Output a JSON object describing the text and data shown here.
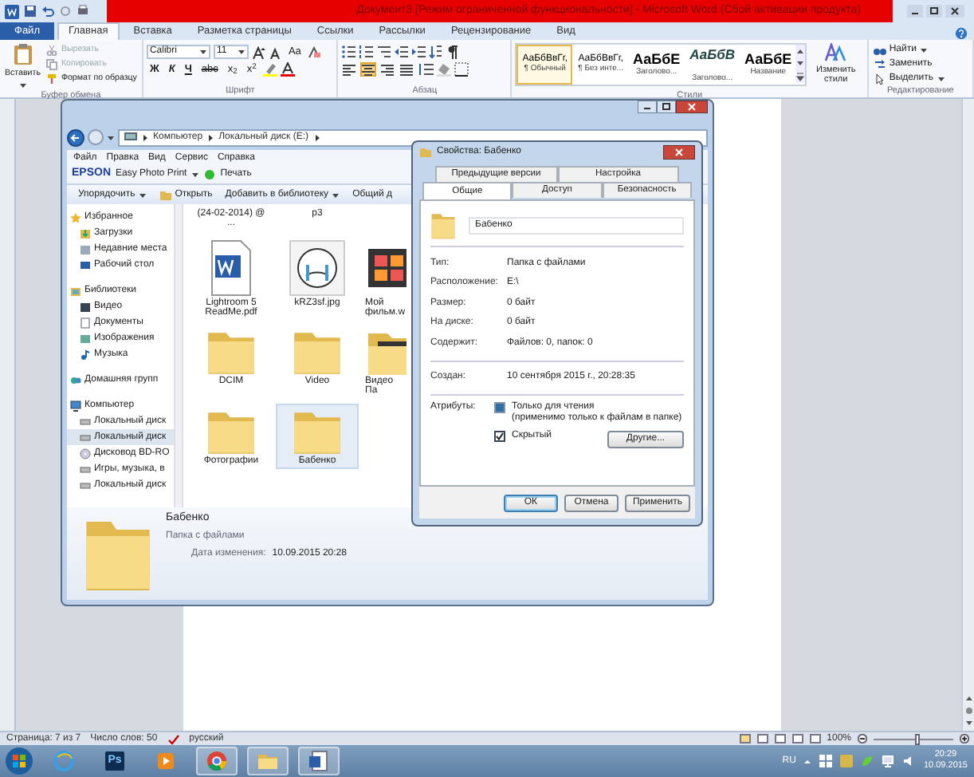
{
  "word": {
    "title": "Документ3 [Режим ограниченной функциональности] - Microsoft Word (Сбой активации продукта)",
    "tabs": [
      {
        "label": "Файл",
        "kind": "file",
        "selected": false
      },
      {
        "label": "Главная",
        "kind": "tab",
        "selected": true
      },
      {
        "label": "Вставка",
        "kind": "tab",
        "selected": false
      },
      {
        "label": "Разметка страницы",
        "kind": "tab",
        "selected": false
      },
      {
        "label": "Ссылки",
        "kind": "tab",
        "selected": false
      },
      {
        "label": "Рассылки",
        "kind": "tab",
        "selected": false
      },
      {
        "label": "Рецензирование",
        "kind": "tab",
        "selected": false
      },
      {
        "label": "Вид",
        "kind": "tab",
        "selected": false
      }
    ],
    "clipboard": {
      "paste": "Вставить",
      "items": [
        {
          "label": "Вырезать",
          "kind": "cut",
          "disabled": true
        },
        {
          "label": "Копировать",
          "kind": "copy",
          "disabled": true
        },
        {
          "label": "Формат по образцу",
          "kind": "brush",
          "disabled": false
        }
      ],
      "group": "Буфер обмена"
    },
    "font": {
      "name": "Calibri",
      "size": "11",
      "case_button": "Aa",
      "style_buttons": [
        "Ж",
        "К",
        "Ч"
      ],
      "effect_buttons": [
        "abc",
        "x$_{2}$",
        "x$^{2}$"
      ],
      "group": "Шрифт"
    },
    "paragraph": {
      "align": [
        {
          "kind": "left",
          "selected": false
        },
        {
          "kind": "center",
          "selected": true
        },
        {
          "kind": "right",
          "selected": false
        },
        {
          "kind": "justify",
          "selected": false
        }
      ],
      "group": "Абзац"
    },
    "styles": {
      "items": [
        {
          "sample": "АаБбВвГг,",
          "name": "¶ Обычный",
          "kind": "body",
          "selected": true
        },
        {
          "sample": "АаБбВвГг,",
          "name": "¶ Без инте...",
          "kind": "body",
          "selected": false
        },
        {
          "sample": "АаБбЕ",
          "name": "Заголово...",
          "kind": "heading",
          "selected": false
        },
        {
          "sample": "АаБбВ",
          "name": "Заголово...",
          "kind": "heading2",
          "selected": false
        },
        {
          "sample": "АаБбЕ",
          "name": "Название",
          "kind": "heading",
          "selected": false
        }
      ],
      "change": "Изменить стили",
      "group": "Стили"
    },
    "editing": {
      "items": [
        {
          "label": "Найти",
          "kind": "find"
        },
        {
          "label": "Заменить",
          "kind": "replace"
        },
        {
          "label": "Выделить",
          "kind": "select"
        }
      ],
      "group": "Редактирование"
    },
    "status_bar": {
      "page": "Страница: 7 из 7",
      "words": "Число слов: 50",
      "language": "русский",
      "zoom": "100%",
      "level": 0.55
    }
  },
  "explorer": {
    "address": [
      "Компьютер",
      "Локальный диск (E:)"
    ],
    "menu": [
      "Файл",
      "Правка",
      "Вид",
      "Сервис",
      "Справка"
    ],
    "epson": {
      "brand": "EPSON",
      "app": "Easy Photo Print",
      "print": "Печать"
    },
    "toolbar": [
      {
        "label": "Упорядочить",
        "kind": "menu"
      },
      {
        "label": "Открыть",
        "kind": "open"
      },
      {
        "label": "Добавить в библиотеку",
        "kind": "menu"
      },
      {
        "label": "Общий д",
        "kind": "plain"
      }
    ],
    "nav": [
      {
        "label": "Избранное",
        "kind": "star",
        "selected": false,
        "children": [
          {
            "label": "Загрузки",
            "kind": "downloads",
            "selected": false
          },
          {
            "label": "Недавние места",
            "kind": "recent",
            "selected": false
          },
          {
            "label": "Рабочий стол",
            "kind": "desktop",
            "selected": false
          }
        ]
      },
      {
        "label": "Библиотеки",
        "kind": "library",
        "selected": false,
        "children": [
          {
            "label": "Видео",
            "kind": "video",
            "selected": false
          },
          {
            "label": "Документы",
            "kind": "documents",
            "selected": false
          },
          {
            "label": "Изображения",
            "kind": "pictures",
            "selected": false
          },
          {
            "label": "Музыка",
            "kind": "music",
            "selected": false
          }
        ]
      },
      {
        "label": "Домашняя групп",
        "kind": "homegroup",
        "selected": false
      },
      {
        "label": "Компьютер",
        "kind": "computer",
        "selected": false,
        "children": [
          {
            "label": "Локальный диск",
            "kind": "disk",
            "selected": false
          },
          {
            "label": "Локальный диск",
            "kind": "disk",
            "selected": true
          },
          {
            "label": "Дисковод BD-RO",
            "kind": "optical",
            "selected": false
          },
          {
            "label": "Игры, музыка, в",
            "kind": "disk",
            "selected": false
          },
          {
            "label": "Локальный диск",
            "kind": "disk",
            "selected": false
          }
        ]
      }
    ],
    "file_rows": [
      [
        {
          "label": "(24-02-2014) @ ...",
          "kind": "cut",
          "selected": false
        },
        {
          "label": "p3",
          "kind": "cut",
          "selected": false
        }
      ],
      [
        {
          "label": "Lightroom 5 ReadMe.pdf",
          "kind": "document",
          "selected": false
        },
        {
          "label": "kRZ3sf.jpg",
          "kind": "image",
          "selected": false
        },
        {
          "label": "Мой фильм.w",
          "kind": "video",
          "selected": false
        }
      ],
      [
        {
          "label": "DCIM",
          "kind": "folder",
          "selected": false
        },
        {
          "label": "Video",
          "kind": "folder",
          "selected": false
        },
        {
          "label": "Видео Па",
          "kind": "folder",
          "selected": false
        }
      ],
      [
        {
          "label": "Фотографии",
          "kind": "folder",
          "selected": false
        },
        {
          "label": "Бабенко",
          "kind": "folder",
          "selected": true
        }
      ]
    ],
    "details": {
      "name": "Бабенко",
      "type": "Папка с файлами",
      "modified_label": "Дата изменения:",
      "modified": "10.09.2015 20:28"
    }
  },
  "properties": {
    "title": "Свойства: Бабенко",
    "tabs_back": [
      {
        "label": "Предыдущие версии",
        "selected": false
      },
      {
        "label": "Настройка",
        "selected": false
      }
    ],
    "tabs_front": [
      {
        "label": "Общие",
        "selected": true
      },
      {
        "label": "Доступ",
        "selected": false
      },
      {
        "label": "Безопасность",
        "selected": false
      }
    ],
    "name": "Бабенко",
    "groups": [
      [
        {
          "label": "Тип:",
          "value": "Папка с файлами"
        },
        {
          "label": "Расположение:",
          "value": "E:\\"
        },
        {
          "label": "Размер:",
          "value": "0 байт"
        },
        {
          "label": "На диске:",
          "value": "0 байт"
        },
        {
          "label": "Содержит:",
          "value": "Файлов: 0, папок: 0"
        }
      ],
      [
        {
          "label": "Создан:",
          "value": "10 сентября 2015 г., 20:28:35"
        }
      ]
    ],
    "attributes": {
      "label": "Атрибуты:",
      "options": [
        {
          "label": "Только для чтения",
          "note": "(применимо только к файлам в папке)",
          "checked": false,
          "mixed": true
        },
        {
          "label": "Скрытый",
          "checked": true,
          "mixed": false
        }
      ],
      "more": "Другие..."
    },
    "buttons": [
      {
        "label": "ОК",
        "default": true
      },
      {
        "label": "Отмена",
        "default": false
      },
      {
        "label": "Применить",
        "default": false
      }
    ]
  },
  "taskbar": {
    "apps": [
      {
        "kind": "ie",
        "running": false
      },
      {
        "kind": "photoshop",
        "label": "Ps",
        "running": false
      },
      {
        "kind": "media",
        "running": false
      },
      {
        "kind": "chrome",
        "running": true
      },
      {
        "kind": "explorer",
        "running": true
      },
      {
        "kind": "word",
        "running": true
      }
    ],
    "language": "RU",
    "time": "20:29",
    "date": "10.09.2015"
  }
}
